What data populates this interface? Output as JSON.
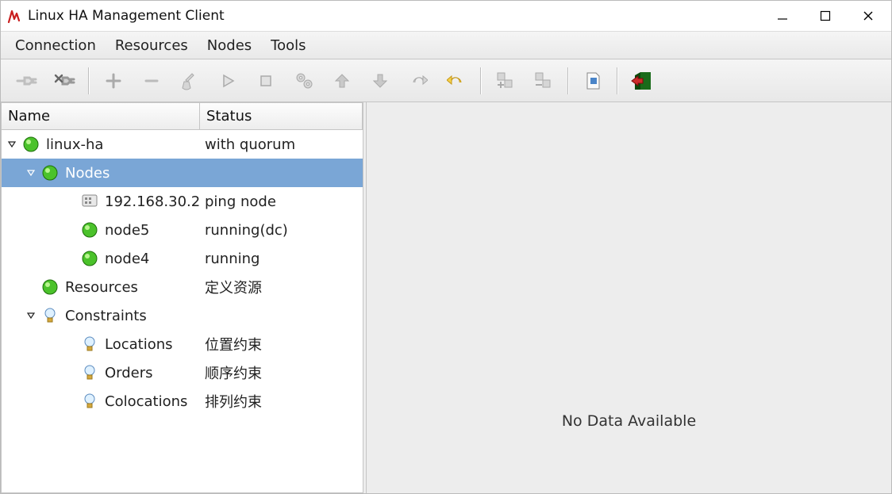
{
  "titlebar": {
    "title": "Linux HA Management Client"
  },
  "menu": {
    "connection": "Connection",
    "resources": "Resources",
    "nodes": "Nodes",
    "tools": "Tools"
  },
  "columns": {
    "name": "Name",
    "status": "Status"
  },
  "tree": {
    "root": {
      "name": "linux-ha",
      "status": "with quorum"
    },
    "nodes": {
      "name": "Nodes",
      "status": ""
    },
    "node_ip": {
      "name": "192.168.30.2",
      "status": "ping node"
    },
    "node5": {
      "name": "node5",
      "status": "running(dc)"
    },
    "node4": {
      "name": "node4",
      "status": "running"
    },
    "resources": {
      "name": "Resources",
      "status": "定义资源"
    },
    "constraints": {
      "name": "Constraints",
      "status": ""
    },
    "locations": {
      "name": "Locations",
      "status": "位置约束"
    },
    "orders": {
      "name": "Orders",
      "status": "顺序约束"
    },
    "colocations": {
      "name": "Colocations",
      "status": "排列约束"
    }
  },
  "details": {
    "empty": "No Data Available"
  }
}
